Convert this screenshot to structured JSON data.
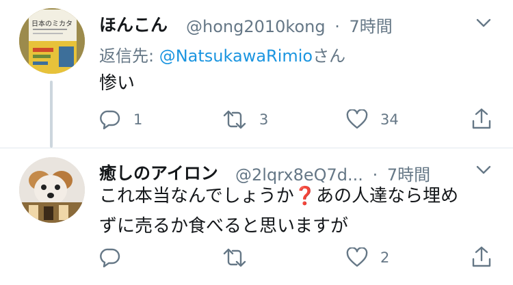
{
  "tweets": [
    {
      "display_name": "ほんこん",
      "handle": "@hong2010kong",
      "separator": "·",
      "time": "7時間",
      "reply_prefix": "返信先: ",
      "reply_mention": "@NatsukawaRimio",
      "reply_suffix": "さん",
      "text": "惨い",
      "actions": {
        "reply_count": "1",
        "retweet_count": "3",
        "like_count": "34",
        "share_count": ""
      },
      "avatar_caption": "日本のミカタ"
    },
    {
      "display_name": "癒しのアイロン",
      "handle": "@2lqrx8eQ7d...",
      "separator": "·",
      "time": "7時間",
      "text_line1_before": "これ本当なんでしょうか",
      "text_line1_emoji": "❓",
      "text_line1_after": "あの人達なら埋め",
      "text_line2": "ずに売るか食べると思いますが",
      "actions": {
        "reply_count": "",
        "retweet_count": "",
        "like_count": "2",
        "share_count": ""
      }
    }
  ],
  "colors": {
    "text": "#14171a",
    "secondary": "#657786",
    "link": "#1b95e0",
    "divider": "#e1e8ed",
    "thread_line": "#ccd6dd"
  }
}
